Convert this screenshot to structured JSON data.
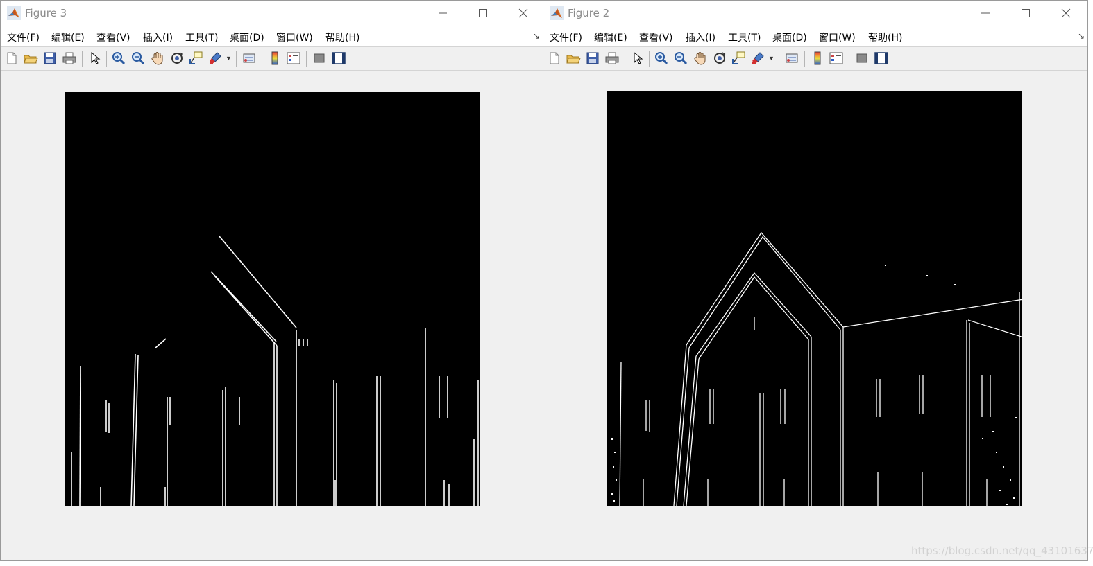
{
  "windows": [
    {
      "title": "Figure 3",
      "menu": [
        "文件(F)",
        "编辑(E)",
        "查看(V)",
        "插入(I)",
        "工具(T)",
        "桌面(D)",
        "窗口(W)",
        "帮助(H)"
      ],
      "image_alt": "Sobel vertical edge detection result of a building"
    },
    {
      "title": "Figure 2",
      "menu": [
        "文件(F)",
        "编辑(E)",
        "查看(V)",
        "插入(I)",
        "工具(T)",
        "桌面(D)",
        "窗口(W)",
        "帮助(H)"
      ],
      "image_alt": "Canny edge detection result of a building"
    }
  ],
  "toolbar_icons": [
    "new-figure-icon",
    "open-file-icon",
    "save-icon",
    "print-icon",
    "edit-plot-icon",
    "zoom-in-icon",
    "zoom-out-icon",
    "pan-icon",
    "rotate-3d-icon",
    "data-cursor-icon",
    "brush-icon",
    "link-plot-icon",
    "insert-colorbar-icon",
    "insert-legend-icon",
    "hide-plot-tools-icon",
    "show-plot-tools-icon"
  ],
  "watermark": "https://blog.csdn.net/qq_43101637",
  "colors": {
    "window_bg": "#f0f0f0",
    "title_text": "#8a8a8a",
    "image_bg": "#000000",
    "edge": "#ffffff"
  }
}
